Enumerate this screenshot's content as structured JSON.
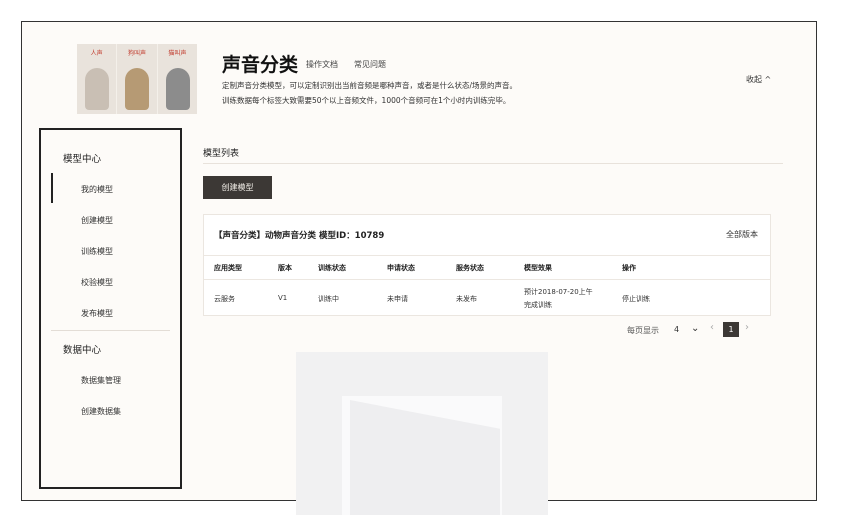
{
  "header": {
    "banner_tags": [
      "人声",
      "狗叫声",
      "猫叫声"
    ],
    "title": "声音分类",
    "links": [
      "操作文档",
      "常见问题"
    ],
    "desc_line1": "定制声音分类模型，可以定制识别出当前音频是哪种声音，或者是什么状态/场景的声音。",
    "desc_line2": "训练数据每个标签大致需要50个以上音频文件，1000个音频可在1个小时内训练完毕。",
    "collapse": "收起 ^"
  },
  "sidebar": {
    "model_center": "模型中心",
    "model_items": [
      "我的模型",
      "创建模型",
      "训练模型",
      "校验模型",
      "发布模型"
    ],
    "data_center": "数据中心",
    "data_items": [
      "数据集管理",
      "创建数据集"
    ]
  },
  "main": {
    "section_title": "模型列表",
    "create_button": "创建模型",
    "card": {
      "title": "【声音分类】动物声音分类 模型ID：10789",
      "all_versions": "全部版本",
      "headers": [
        "应用类型",
        "版本",
        "训练状态",
        "申请状态",
        "服务状态",
        "模型效果",
        "操作"
      ],
      "row": {
        "app_type": "云服务",
        "version": "V1",
        "train_status": "训练中",
        "apply_status": "未申请",
        "service_status": "未发布",
        "effect_line1": "预计2018-07-20上午",
        "effect_line2": "完成训练",
        "action": "停止训练"
      }
    },
    "pager": {
      "per_page_label": "每页显示",
      "page_size": "4",
      "current_page": "1"
    }
  }
}
